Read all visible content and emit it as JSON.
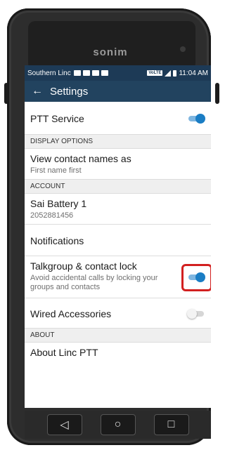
{
  "device": {
    "brand": "sonim"
  },
  "status_bar": {
    "carrier": "Southern Linc",
    "time": "11:04 AM",
    "volte": "VoLTE"
  },
  "app_bar": {
    "back_icon": "←",
    "title": "Settings"
  },
  "rows": {
    "ptt_service": {
      "title": "PTT Service",
      "toggle": "on"
    },
    "display_options_header": "DISPLAY OPTIONS",
    "view_contact_names": {
      "title": "View contact names as",
      "subtitle": "First name first"
    },
    "account_header": "ACCOUNT",
    "account": {
      "title": "Sai Battery 1",
      "subtitle": "2052881456"
    },
    "notifications": {
      "title": "Notifications"
    },
    "talkgroup_lock": {
      "title": "Talkgroup & contact lock",
      "subtitle": "Avoid accidental calls by locking your groups and contacts",
      "toggle": "on"
    },
    "wired_accessories": {
      "title": "Wired Accessories",
      "toggle": "off"
    },
    "about_header": "ABOUT",
    "about_partial": "About Linc PTT"
  },
  "nav": {
    "back": "◁",
    "home": "○",
    "recent": "□"
  },
  "colors": {
    "status_bar": "#1d3a56",
    "app_bar": "#22435f",
    "accent": "#1a7dc4",
    "highlight": "#d22020"
  }
}
